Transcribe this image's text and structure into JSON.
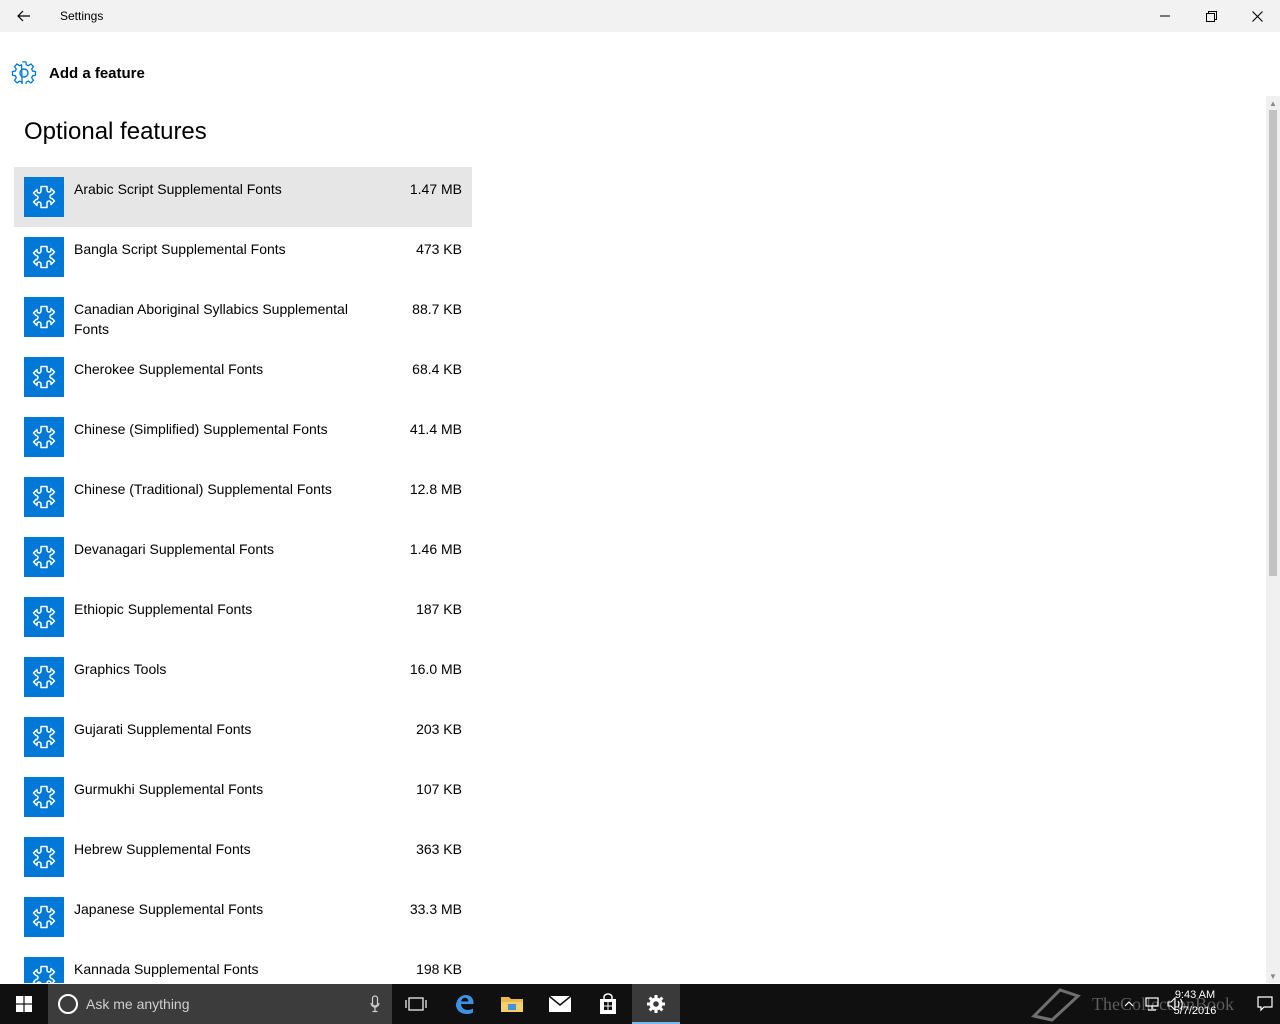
{
  "window": {
    "title": "Settings"
  },
  "add_feature": {
    "label": "Add a feature"
  },
  "page": {
    "heading": "Optional features"
  },
  "features": [
    {
      "name": "Arabic Script Supplemental Fonts",
      "size": "1.47 MB",
      "selected": true
    },
    {
      "name": "Bangla Script Supplemental Fonts",
      "size": "473 KB"
    },
    {
      "name": "Canadian Aboriginal Syllabics Supplemental Fonts",
      "size": "88.7 KB"
    },
    {
      "name": "Cherokee Supplemental Fonts",
      "size": "68.4 KB"
    },
    {
      "name": "Chinese (Simplified) Supplemental Fonts",
      "size": "41.4 MB"
    },
    {
      "name": "Chinese (Traditional) Supplemental Fonts",
      "size": "12.8 MB"
    },
    {
      "name": "Devanagari Supplemental Fonts",
      "size": "1.46 MB"
    },
    {
      "name": "Ethiopic Supplemental Fonts",
      "size": "187 KB"
    },
    {
      "name": "Graphics Tools",
      "size": "16.0 MB"
    },
    {
      "name": "Gujarati Supplemental Fonts",
      "size": "203 KB"
    },
    {
      "name": "Gurmukhi Supplemental Fonts",
      "size": "107 KB"
    },
    {
      "name": "Hebrew Supplemental Fonts",
      "size": "363 KB"
    },
    {
      "name": "Japanese Supplemental Fonts",
      "size": "33.3 MB"
    },
    {
      "name": "Kannada Supplemental Fonts",
      "size": "198 KB"
    }
  ],
  "taskbar": {
    "search_placeholder": "Ask me anything",
    "clock_time": "9:43 AM",
    "clock_date": "5/7/2016",
    "watermark": "TheCollectionBook"
  },
  "colors": {
    "accent": "#0078d7",
    "selected_row": "#e6e6e6",
    "titlebar": "#f2f2f2",
    "taskbar": "#101010"
  }
}
